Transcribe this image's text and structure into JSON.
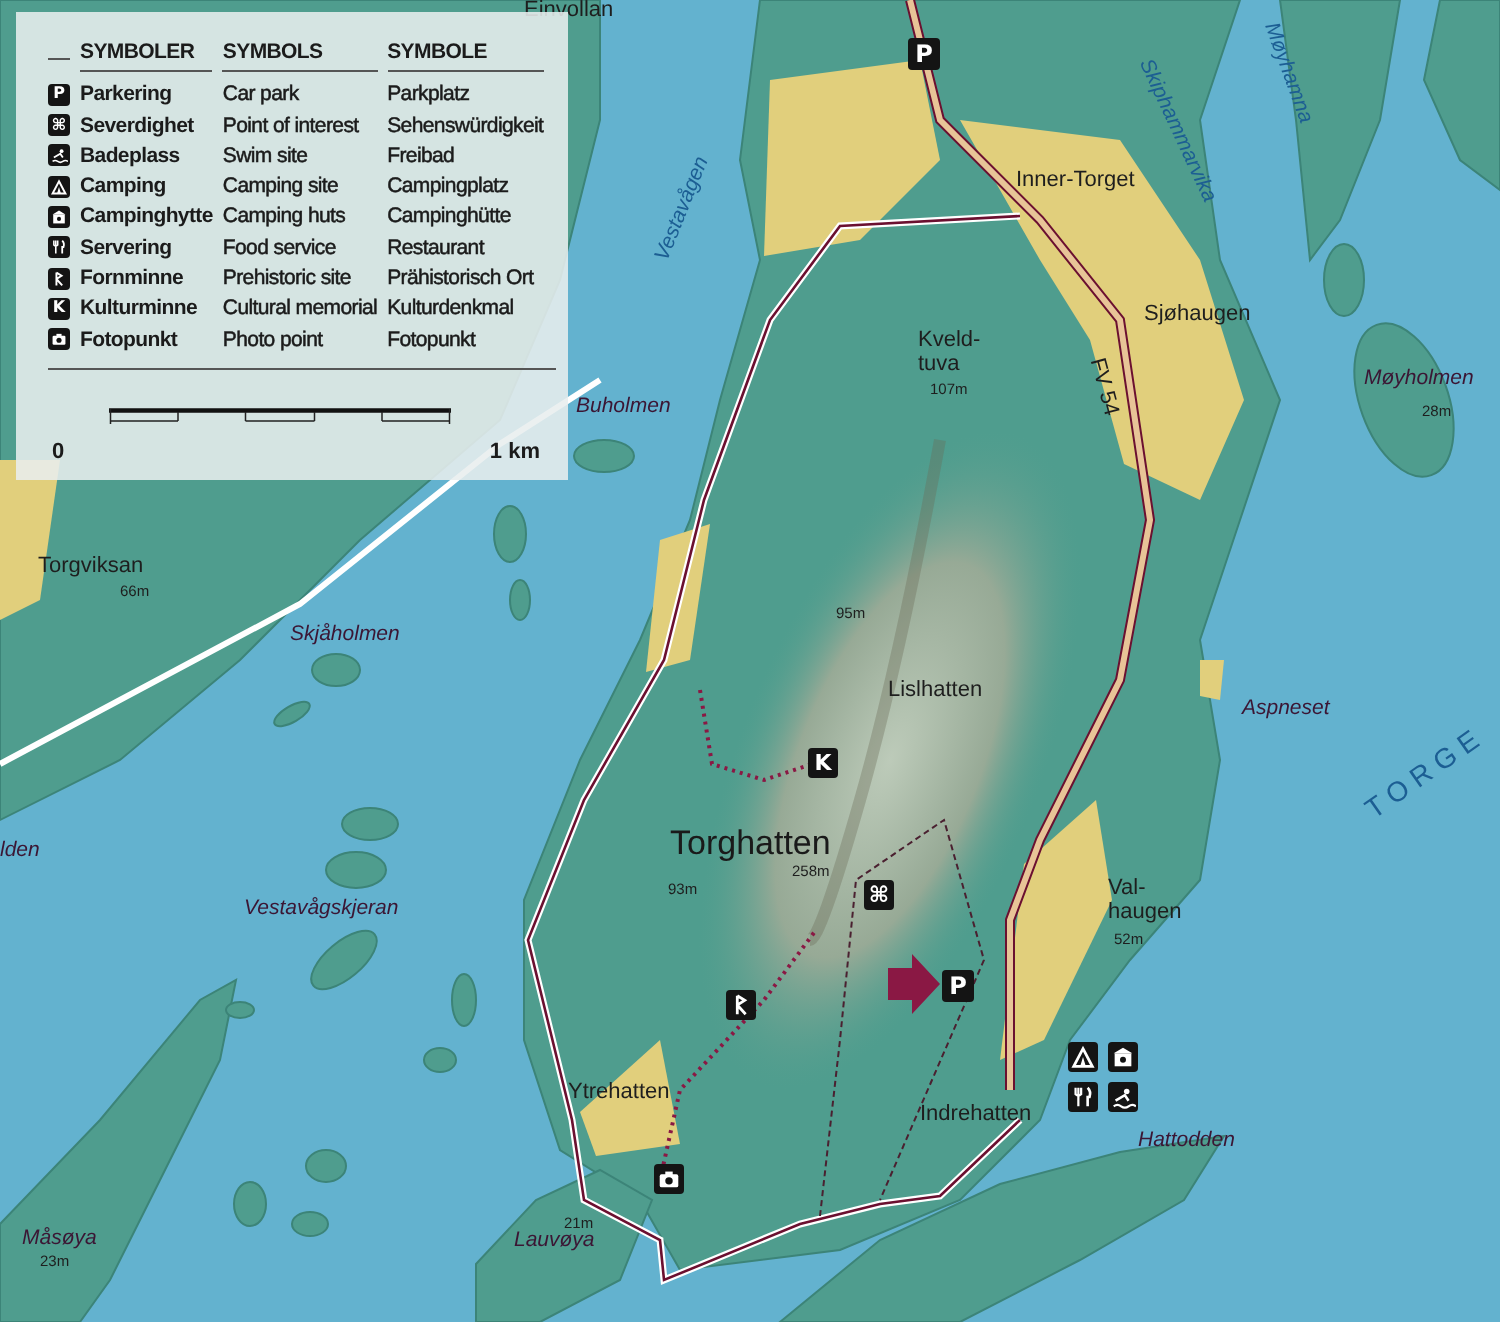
{
  "legend": {
    "columns": [
      "SYMBOLER",
      "SYMBOLS",
      "SYMBOLE"
    ],
    "items": [
      {
        "kind": "parking",
        "symbol": "P",
        "no": "Parkering",
        "en": "Car park",
        "de": "Parkplatz"
      },
      {
        "kind": "poi",
        "symbol": "⌘",
        "no": "Severdighet",
        "en": "Point of interest",
        "de": "Sehenswürdigkeit"
      },
      {
        "kind": "swim",
        "no": "Badeplass",
        "en": "Swim site",
        "de": "Freibad"
      },
      {
        "kind": "camping",
        "no": "Camping",
        "en": "Camping site",
        "de": "Campingplatz"
      },
      {
        "kind": "hut",
        "no": "Campinghytte",
        "en": "Camping huts",
        "de": "Campinghütte"
      },
      {
        "kind": "food",
        "no": "Servering",
        "en": "Food service",
        "de": "Restaurant"
      },
      {
        "kind": "prehistoric",
        "no": "Fornminne",
        "en": "Prehistoric site",
        "de": "Prähistorisch Ort"
      },
      {
        "kind": "culture",
        "symbol": "K",
        "no": "Kulturminne",
        "en": "Cultural memorial",
        "de": "Kulturdenkmal"
      },
      {
        "kind": "photo",
        "no": "Fotopunkt",
        "en": "Photo point",
        "de": "Fotopunkt"
      }
    ],
    "scale": {
      "start": "0",
      "end": "1 km"
    }
  },
  "map": {
    "labels": [
      {
        "kind": "place",
        "text": "Einvollan"
      },
      {
        "kind": "water",
        "text": "Møyhamna"
      },
      {
        "kind": "water",
        "text": "Skiphammarvika"
      },
      {
        "kind": "place",
        "text": "Inner-Torget"
      },
      {
        "kind": "water",
        "text": "Vestavågen"
      },
      {
        "kind": "place",
        "text": "Sjøhaugen"
      },
      {
        "kind": "place",
        "text": "Kveld-tuva"
      },
      {
        "kind": "elevation",
        "text": "107m"
      },
      {
        "kind": "place",
        "text": "FV 54"
      },
      {
        "kind": "island",
        "text": "Møyholmen"
      },
      {
        "kind": "elevation",
        "text": "28m"
      },
      {
        "kind": "island",
        "text": "Buholmen"
      },
      {
        "kind": "place",
        "text": "Torgviksan"
      },
      {
        "kind": "elevation",
        "text": "66m"
      },
      {
        "kind": "elevation",
        "text": "95m"
      },
      {
        "kind": "island",
        "text": "Skjåholmen"
      },
      {
        "kind": "place",
        "text": "Lislhatten"
      },
      {
        "kind": "island",
        "text": "Aspneset"
      },
      {
        "kind": "sea",
        "text": "TORGE"
      },
      {
        "kind": "island",
        "text": "lden"
      },
      {
        "kind": "peak",
        "text": "Torghatten"
      },
      {
        "kind": "elevation",
        "text": "258m"
      },
      {
        "kind": "elevation",
        "text": "93m"
      },
      {
        "kind": "island",
        "text": "Vestavågskjeran"
      },
      {
        "kind": "place",
        "text": "Val-haugen"
      },
      {
        "kind": "elevation",
        "text": "52m"
      },
      {
        "kind": "place",
        "text": "Ytrehatten"
      },
      {
        "kind": "place",
        "text": "Indrehatten"
      },
      {
        "kind": "island",
        "text": "Hattodden"
      },
      {
        "kind": "elevation",
        "text": "21m"
      },
      {
        "kind": "island",
        "text": "Lauvøya"
      },
      {
        "kind": "island",
        "text": "Måsøya"
      },
      {
        "kind": "elevation",
        "text": "23m"
      }
    ],
    "markers": [
      {
        "kind": "parking",
        "symbol": "P"
      },
      {
        "kind": "culture",
        "symbol": "K"
      },
      {
        "kind": "poi",
        "symbol": "⌘"
      },
      {
        "kind": "prehistoric"
      },
      {
        "kind": "parking",
        "symbol": "P"
      },
      {
        "kind": "camping"
      },
      {
        "kind": "hut"
      },
      {
        "kind": "food"
      },
      {
        "kind": "swim"
      },
      {
        "kind": "photo"
      }
    ]
  }
}
